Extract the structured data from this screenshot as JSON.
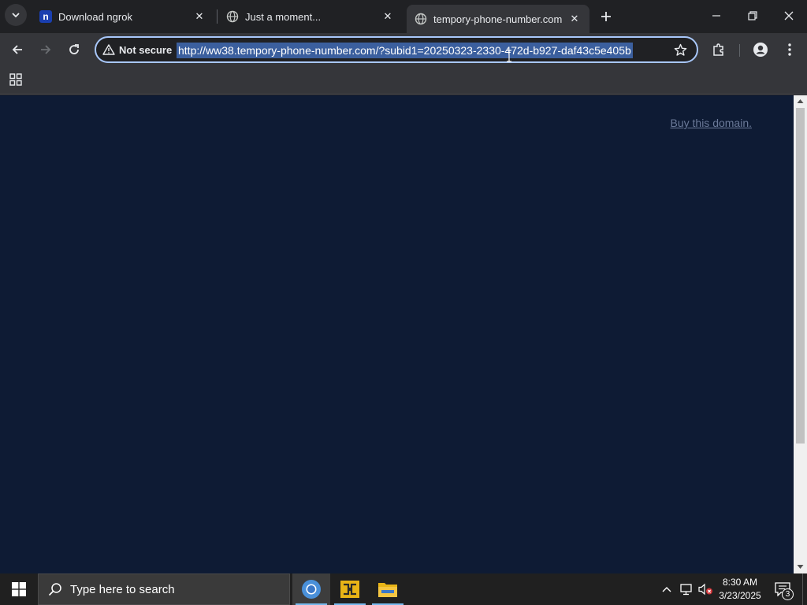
{
  "tabs": [
    {
      "title": "Download ngrok",
      "favicon": "ngrok-icon",
      "active": false
    },
    {
      "title": "Just a moment...",
      "favicon": "globe-icon",
      "active": false
    },
    {
      "title": "tempory-phone-number.com",
      "favicon": "globe-icon",
      "active": true
    }
  ],
  "toolbar": {
    "security_label": "Not secure",
    "url": "http://ww38.tempory-phone-number.com/?subid1=20250323-2330-472d-b927-daf43c5e405b"
  },
  "page": {
    "buy_link": "Buy this domain.",
    "background_color": "#0e1b34"
  },
  "taskbar": {
    "search_placeholder": "Type here to search",
    "time": "8:30 AM",
    "date": "3/23/2025",
    "notification_count": "3"
  },
  "colors": {
    "accent": "#a8c7fa",
    "url_selection": "#3b5f9e",
    "link": "#6b7a99"
  }
}
